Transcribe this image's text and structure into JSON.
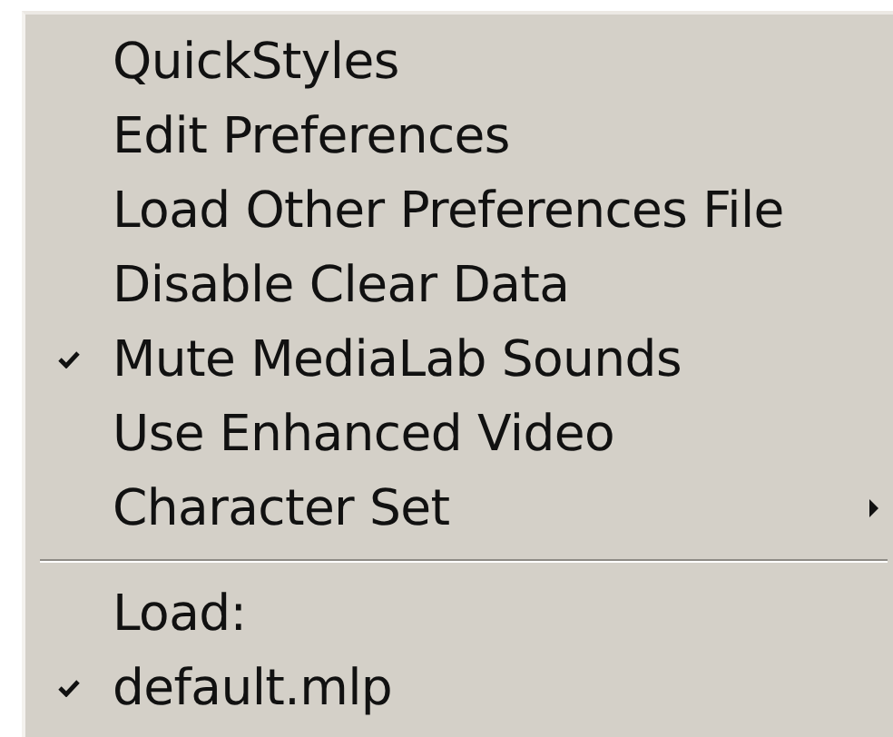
{
  "menu": {
    "items": [
      {
        "kind": "item",
        "label": "QuickStyles",
        "checked": false
      },
      {
        "kind": "item",
        "label": "Edit Preferences",
        "checked": false
      },
      {
        "kind": "item",
        "label": "Load Other Preferences File",
        "checked": false
      },
      {
        "kind": "item",
        "label": "Disable Clear Data",
        "checked": false
      },
      {
        "kind": "item",
        "label": "Mute MediaLab Sounds",
        "checked": true
      },
      {
        "kind": "item",
        "label": "Use Enhanced Video",
        "checked": false
      },
      {
        "kind": "submenu",
        "label": "Character Set",
        "checked": false
      },
      {
        "kind": "separator"
      },
      {
        "kind": "header",
        "label": "Load:"
      },
      {
        "kind": "item",
        "label": "default.mlp",
        "checked": true
      }
    ]
  }
}
